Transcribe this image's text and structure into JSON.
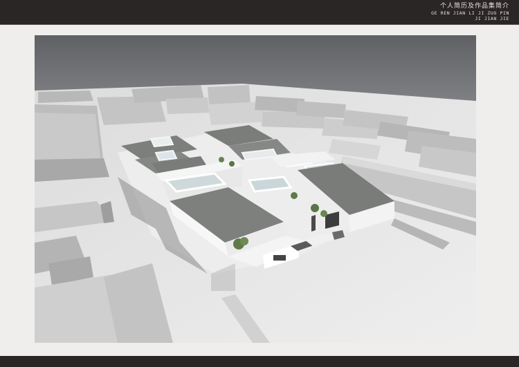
{
  "header": {
    "title_cn": "个人简历及作品集简介",
    "title_pinyin_1": "GE REN JIAN LI JI ZUO PIN",
    "title_pinyin_2": "JI JIAN JIE"
  },
  "colors": {
    "bar": "#2b2626",
    "page": "#efeeec",
    "sky": "#6b6d70",
    "ground": "#e6e6e6",
    "roof": "#7d7f7d",
    "wall": "#f5f5f5",
    "glass": "#cfe0e6"
  }
}
